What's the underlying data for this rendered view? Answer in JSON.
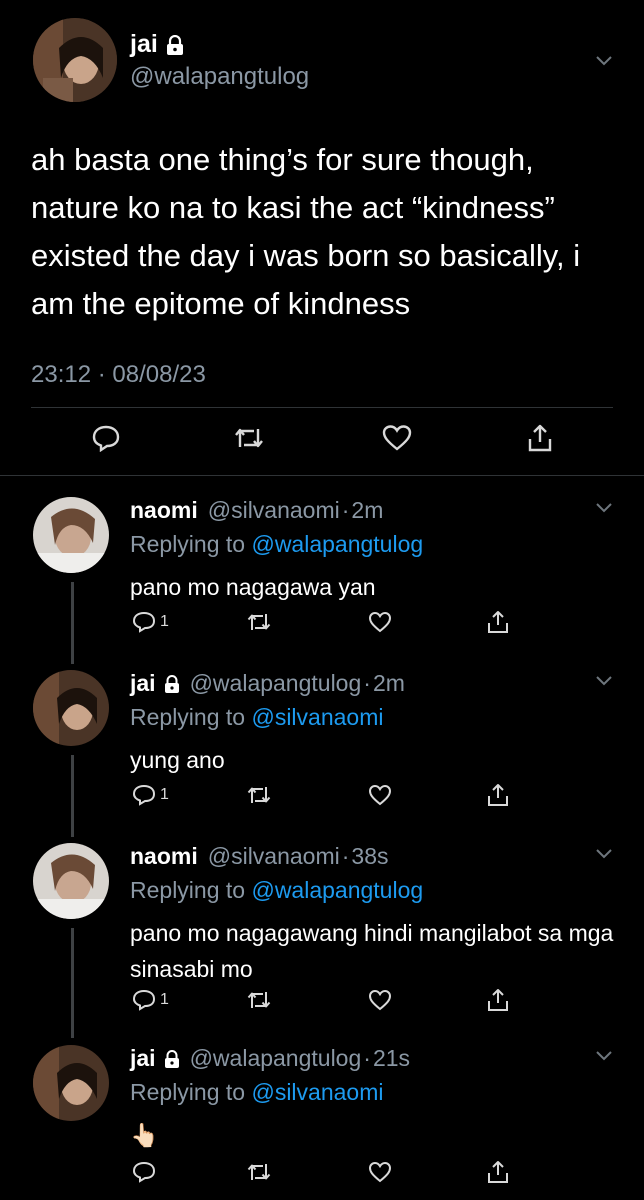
{
  "main_tweet": {
    "name": "jai",
    "handle": "@walapangtulog",
    "text": "ah basta one thing’s for sure though, nature ko na to kasi the act “kindness” existed the day i was born so basically, i am the epitome of kindness",
    "timestamp": "23:12 · 08/08/23",
    "icons": [
      "reply-icon",
      "retweet-icon",
      "like-icon",
      "share-icon"
    ]
  },
  "replies": [
    {
      "name": "naomi",
      "handle": "@silvanaomi",
      "time": "2m",
      "replying_prefix": "Replying to",
      "replying_to": "@walapangtulog",
      "text": "pano mo nagagawa yan",
      "reply_count": "1",
      "locked": false
    },
    {
      "name": "jai",
      "handle": "@walapangtulog",
      "time": "2m",
      "replying_prefix": "Replying to",
      "replying_to": "@silvanaomi",
      "text": "yung ano",
      "reply_count": "1",
      "locked": true
    },
    {
      "name": "naomi",
      "handle": "@silvanaomi",
      "time": "38s",
      "replying_prefix": "Replying to",
      "replying_to": "@walapangtulog",
      "text": "pano mo nagagawang hindi mangilabot sa mga sinasabi mo",
      "reply_count": "1",
      "locked": false
    },
    {
      "name": "jai",
      "handle": "@walapangtulog",
      "time": "21s",
      "replying_prefix": "Replying to",
      "replying_to": "@silvanaomi",
      "text": "👆🏻",
      "reply_count": "",
      "locked": true
    }
  ],
  "colors": {
    "background": "#000000",
    "text": "#ffffff",
    "muted": "#8b98a5",
    "link": "#1d9bf0",
    "divider": "#2f3336"
  }
}
